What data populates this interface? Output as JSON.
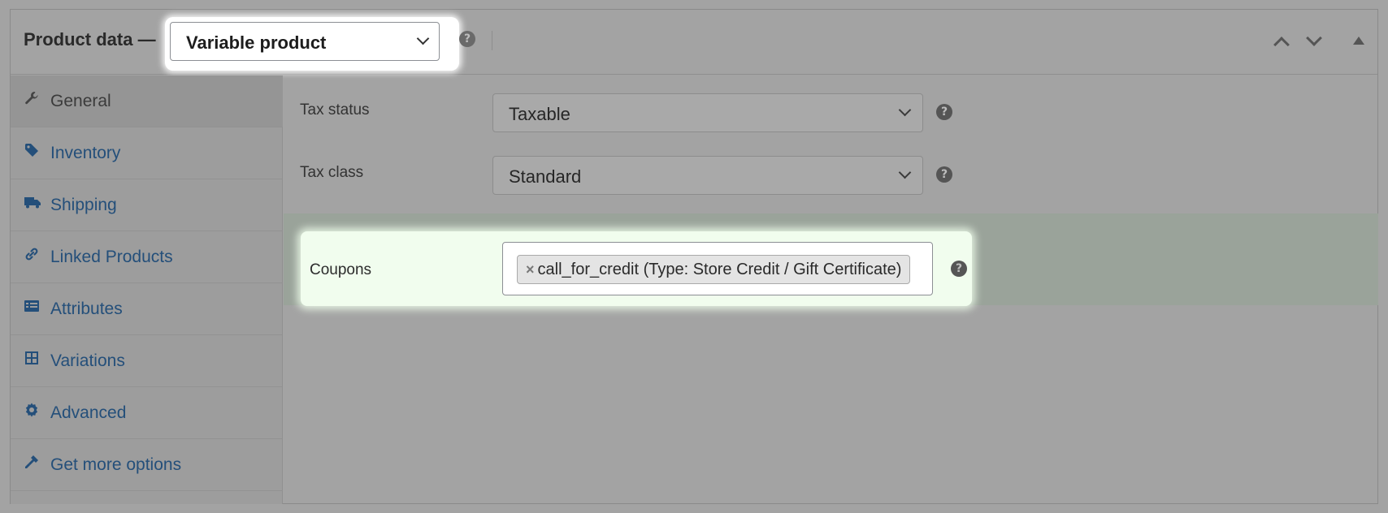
{
  "header": {
    "title": "Product data —",
    "product_type": "Variable product",
    "help": "?"
  },
  "tabs": [
    {
      "label": "General",
      "icon": "wrench-icon",
      "active": true
    },
    {
      "label": "Inventory",
      "icon": "tag-icon",
      "active": false
    },
    {
      "label": "Shipping",
      "icon": "truck-icon",
      "active": false
    },
    {
      "label": "Linked Products",
      "icon": "link-icon",
      "active": false
    },
    {
      "label": "Attributes",
      "icon": "list-icon",
      "active": false
    },
    {
      "label": "Variations",
      "icon": "grid-icon",
      "active": false
    },
    {
      "label": "Advanced",
      "icon": "gear-icon",
      "active": false
    },
    {
      "label": "Get more options",
      "icon": "plug-icon",
      "active": false
    }
  ],
  "fields": {
    "tax_status": {
      "label": "Tax status",
      "value": "Taxable"
    },
    "tax_class": {
      "label": "Tax class",
      "value": "Standard"
    },
    "coupons": {
      "label": "Coupons",
      "chip_remove": "×",
      "chip": "call_for_credit (Type: Store Credit / Gift Certificate)"
    }
  },
  "help": "?",
  "colors": {
    "link": "#244f7a",
    "highlight": "#f1fdee",
    "overlay": "#a3a3a3"
  }
}
